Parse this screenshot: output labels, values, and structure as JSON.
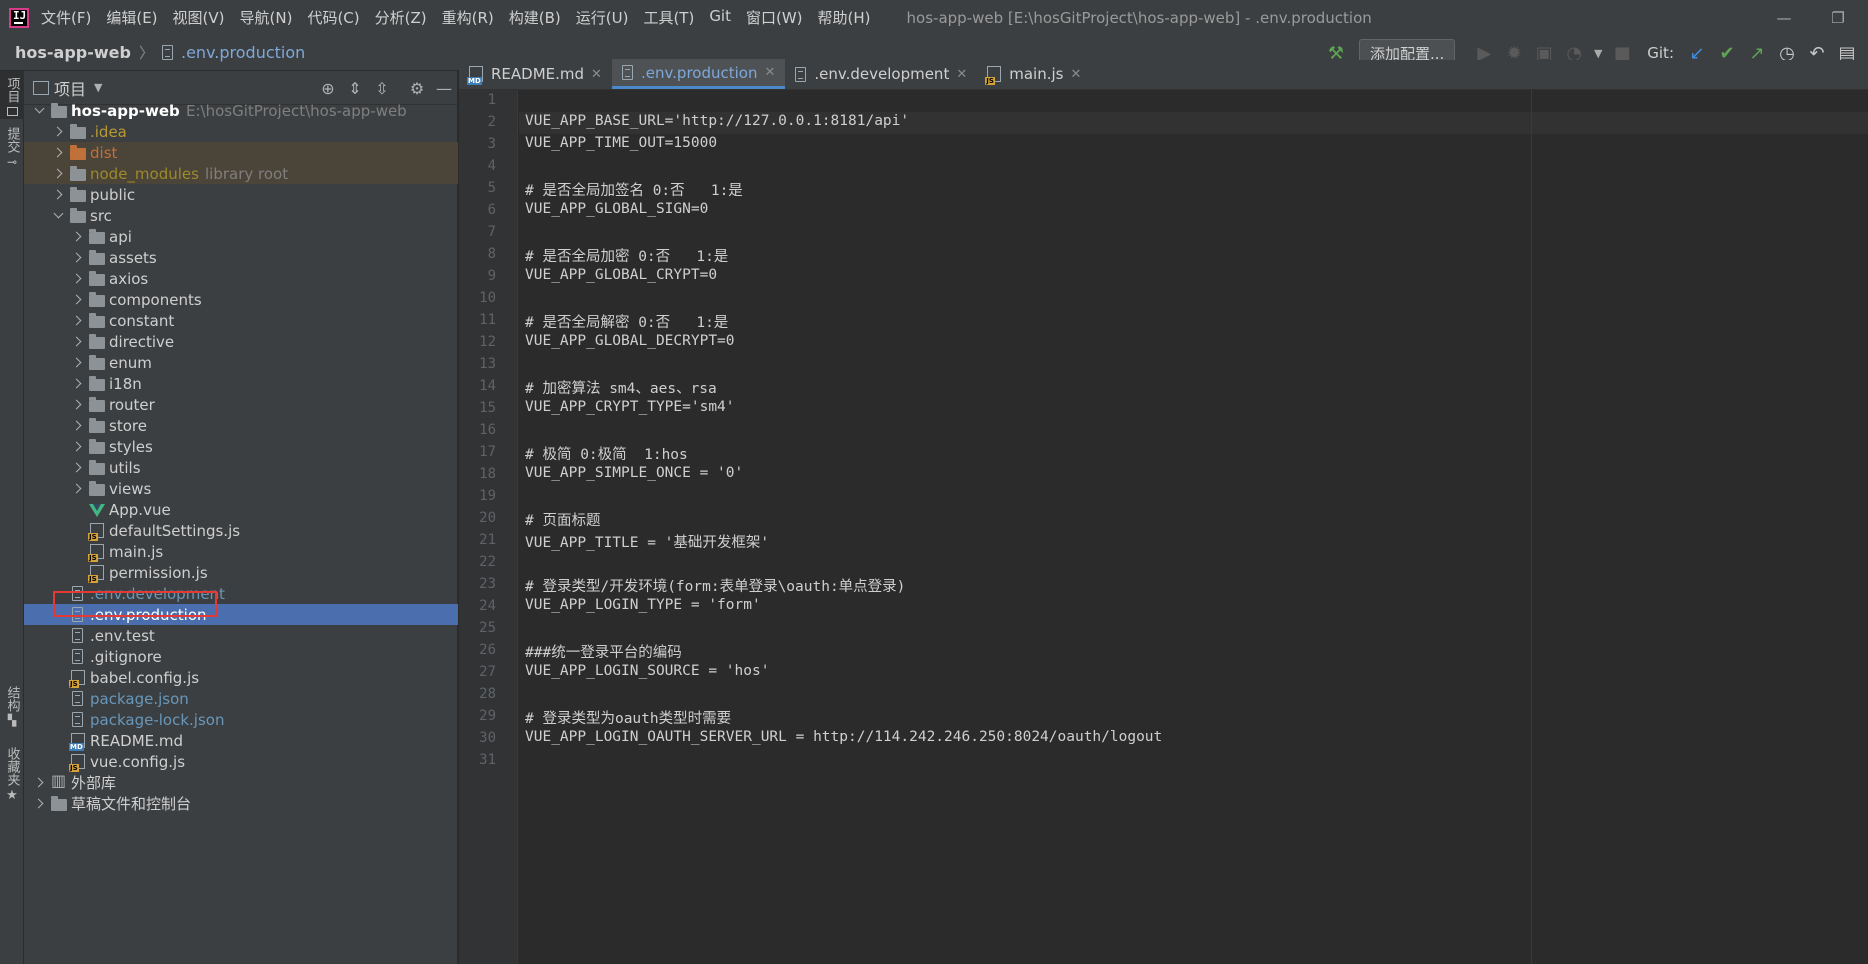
{
  "menubar": {
    "items": [
      "文件(F)",
      "编辑(E)",
      "视图(V)",
      "导航(N)",
      "代码(C)",
      "分析(Z)",
      "重构(R)",
      "构建(B)",
      "运行(U)",
      "工具(T)",
      "Git",
      "窗口(W)",
      "帮助(H)"
    ],
    "window_title": "hos-app-web [E:\\hosGitProject\\hos-app-web] - .env.production"
  },
  "navbar": {
    "project": "hos-app-web",
    "file": ".env.production",
    "add_config": "添加配置...",
    "git_label": "Git:"
  },
  "left_stripe": {
    "project_tab": "项目",
    "commit_tab": "提交",
    "structure_tab": "结构",
    "favorites_tab": "收藏夹"
  },
  "project_panel": {
    "title": "项目",
    "tree": [
      {
        "label": "hos-app-web",
        "suffix": "E:\\hosGitProject\\hos-app-web",
        "depth": 0,
        "kind": "root",
        "expanded": true,
        "color": "bright"
      },
      {
        "label": ".idea",
        "depth": 1,
        "kind": "folder",
        "color": "yellow"
      },
      {
        "label": "dist",
        "depth": 1,
        "kind": "folder-orange",
        "color": "orange",
        "highlight": true
      },
      {
        "label": "node_modules",
        "suffix": "library root",
        "depth": 1,
        "kind": "folder",
        "color": "olive",
        "highlight": true
      },
      {
        "label": "public",
        "depth": 1,
        "kind": "folder",
        "color": "normal"
      },
      {
        "label": "src",
        "depth": 1,
        "kind": "folder",
        "color": "normal",
        "expanded": true
      },
      {
        "label": "api",
        "depth": 2,
        "kind": "folder",
        "color": "normal"
      },
      {
        "label": "assets",
        "depth": 2,
        "kind": "folder",
        "color": "normal"
      },
      {
        "label": "axios",
        "depth": 2,
        "kind": "folder",
        "color": "normal"
      },
      {
        "label": "components",
        "depth": 2,
        "kind": "folder",
        "color": "normal"
      },
      {
        "label": "constant",
        "depth": 2,
        "kind": "folder",
        "color": "normal"
      },
      {
        "label": "directive",
        "depth": 2,
        "kind": "folder",
        "color": "normal"
      },
      {
        "label": "enum",
        "depth": 2,
        "kind": "folder",
        "color": "normal"
      },
      {
        "label": "i18n",
        "depth": 2,
        "kind": "folder",
        "color": "normal"
      },
      {
        "label": "router",
        "depth": 2,
        "kind": "folder",
        "color": "normal"
      },
      {
        "label": "store",
        "depth": 2,
        "kind": "folder",
        "color": "normal"
      },
      {
        "label": "styles",
        "depth": 2,
        "kind": "folder",
        "color": "normal"
      },
      {
        "label": "utils",
        "depth": 2,
        "kind": "folder",
        "color": "normal"
      },
      {
        "label": "views",
        "depth": 2,
        "kind": "folder",
        "color": "normal"
      },
      {
        "label": "App.vue",
        "depth": 2,
        "kind": "vue",
        "color": "normal",
        "leaf": true
      },
      {
        "label": "defaultSettings.js",
        "depth": 2,
        "kind": "js",
        "color": "normal",
        "leaf": true
      },
      {
        "label": "main.js",
        "depth": 2,
        "kind": "js",
        "color": "normal",
        "leaf": true
      },
      {
        "label": "permission.js",
        "depth": 2,
        "kind": "js",
        "color": "normal",
        "leaf": true
      },
      {
        "label": ".env.development",
        "depth": 1,
        "kind": "file",
        "color": "blue",
        "leaf": true
      },
      {
        "label": ".env.production",
        "depth": 1,
        "kind": "file",
        "color": "bright",
        "leaf": true,
        "selected": true
      },
      {
        "label": ".env.test",
        "depth": 1,
        "kind": "file",
        "color": "normal",
        "leaf": true
      },
      {
        "label": ".gitignore",
        "depth": 1,
        "kind": "file",
        "color": "normal",
        "leaf": true
      },
      {
        "label": "babel.config.js",
        "depth": 1,
        "kind": "js",
        "color": "normal",
        "leaf": true
      },
      {
        "label": "package.json",
        "depth": 1,
        "kind": "file",
        "color": "blue",
        "leaf": true
      },
      {
        "label": "package-lock.json",
        "depth": 1,
        "kind": "file",
        "color": "blue",
        "leaf": true
      },
      {
        "label": "README.md",
        "depth": 1,
        "kind": "md",
        "color": "normal",
        "leaf": true
      },
      {
        "label": "vue.config.js",
        "depth": 1,
        "kind": "js",
        "color": "normal",
        "leaf": true
      },
      {
        "label": "外部库",
        "depth": 0,
        "kind": "lib",
        "color": "normal"
      },
      {
        "label": "草稿文件和控制台",
        "depth": 0,
        "kind": "scratch",
        "color": "normal"
      }
    ]
  },
  "tabs": [
    {
      "label": "README.md",
      "icon": "md",
      "active": false
    },
    {
      "label": ".env.production",
      "icon": "file",
      "active": true
    },
    {
      "label": ".env.development",
      "icon": "file",
      "active": false
    },
    {
      "label": "main.js",
      "icon": "js",
      "active": false
    }
  ],
  "editor": {
    "lines": [
      "",
      "VUE_APP_BASE_URL='http://127.0.0.1:8181/api'",
      "VUE_APP_TIME_OUT=15000",
      "",
      "# 是否全局加签名 0:否   1:是",
      "VUE_APP_GLOBAL_SIGN=0",
      "",
      "# 是否全局加密 0:否   1:是",
      "VUE_APP_GLOBAL_CRYPT=0",
      "",
      "# 是否全局解密 0:否   1:是",
      "VUE_APP_GLOBAL_DECRYPT=0",
      "",
      "# 加密算法 sm4、aes、rsa",
      "VUE_APP_CRYPT_TYPE='sm4'",
      "",
      "# 极简 0:极简  1:hos",
      "VUE_APP_SIMPLE_ONCE = '0'",
      "",
      "# 页面标题",
      "VUE_APP_TITLE = '基础开发框架'",
      "",
      "# 登录类型/开发环境(form:表单登录\\oauth:单点登录)",
      "VUE_APP_LOGIN_TYPE = 'form'",
      "",
      "###统一登录平台的编码",
      "VUE_APP_LOGIN_SOURCE = 'hos'",
      "",
      "# 登录类型为oauth类型时需要",
      "VUE_APP_LOGIN_OAUTH_SERVER_URL = http://114.242.246.250:8024/oauth/logout",
      ""
    ],
    "current_line": 2
  }
}
